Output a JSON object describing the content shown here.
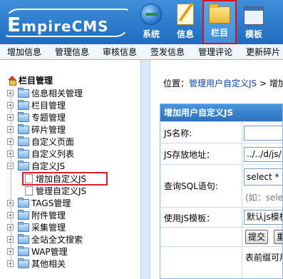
{
  "header": {
    "logo_prefix": "E",
    "logo_rest": "mpireCMS",
    "nav": [
      {
        "label": "系统",
        "icon": "globe-icon"
      },
      {
        "label": "信息",
        "icon": "document-pencil-icon"
      },
      {
        "label": "栏目",
        "icon": "folder-icon",
        "active": true
      },
      {
        "label": "模板",
        "icon": "template-window-icon"
      }
    ]
  },
  "subbar": [
    "增加信息",
    "管理信息",
    "审核信息",
    "签发信息",
    "管理评论",
    "更新碎片"
  ],
  "tree": {
    "title": "栏目管理",
    "items": [
      {
        "label": "信息相关管理"
      },
      {
        "label": "栏目管理"
      },
      {
        "label": "专题管理"
      },
      {
        "label": "碎片管理"
      },
      {
        "label": "自定义页面"
      },
      {
        "label": "自定义列表"
      },
      {
        "label": "自定义JS",
        "expanded": true
      },
      {
        "label": "增加自定义JS",
        "child": true,
        "highlighted": true
      },
      {
        "label": "管理自定义JS",
        "child": true
      },
      {
        "label": "TAGS管理"
      },
      {
        "label": "附件管理"
      },
      {
        "label": "采集管理"
      },
      {
        "label": "全站全文搜索"
      },
      {
        "label": "WAP管理"
      },
      {
        "label": "其他相关"
      }
    ],
    "expand_symbol": "+",
    "collapse_symbol": "−"
  },
  "breadcrumb": {
    "prefix": "位置：",
    "link": "管理用户自定义JS",
    "sep": " > ",
    "current": "增加"
  },
  "form": {
    "title": "增加用户自定义JS",
    "name_label": "JS名称:",
    "name_value": "",
    "path_label": "JS存放地址：",
    "path_value": "../../d/js/",
    "sql_label": "查询SQL语句:",
    "sql_value": "select * fr",
    "sql_hint": "(如：selec",
    "template_label": "使用JS模板：",
    "template_value": "默认js模板",
    "submit_label": "提交",
    "reset_label": "重",
    "footer_note": "表前缀可用"
  }
}
